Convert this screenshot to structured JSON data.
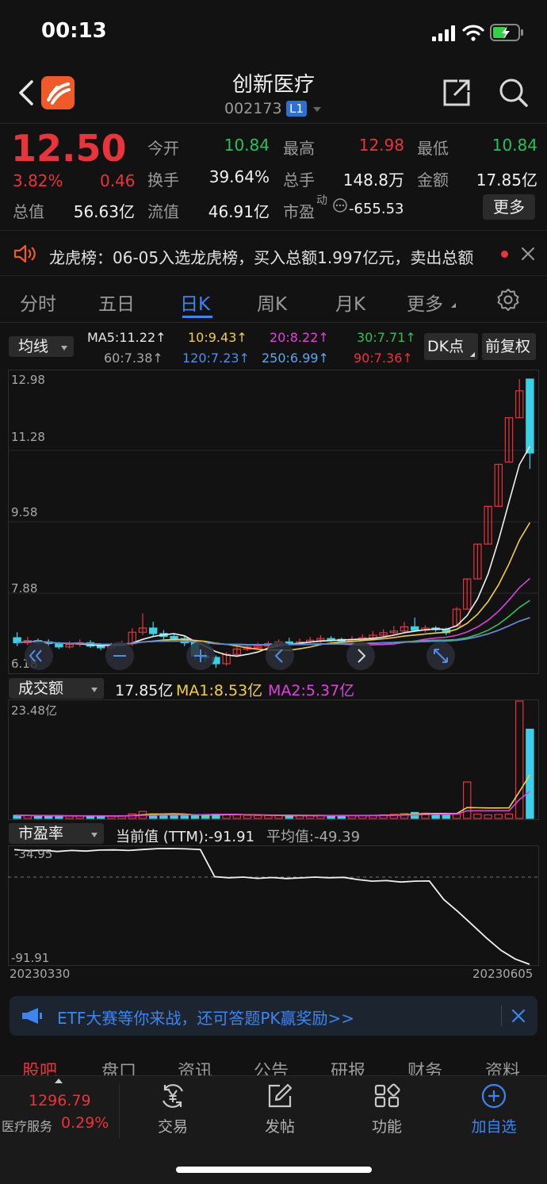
{
  "status": {
    "time": "00:13"
  },
  "header": {
    "title": "创新医疗",
    "code": "002173",
    "level": "L1"
  },
  "quote": {
    "price": "12.50",
    "change_pct": "3.82%",
    "change": "0.46",
    "rows": [
      [
        {
          "label": "今开",
          "value": "10.84",
          "color": "green"
        },
        {
          "label": "最高",
          "value": "12.98",
          "color": "red"
        },
        {
          "label": "最低",
          "value": "10.84",
          "color": "green"
        }
      ],
      [
        {
          "label": "换手",
          "value": "39.64%",
          "color": "white"
        },
        {
          "label": "总手",
          "value": "148.8万",
          "color": "white"
        },
        {
          "label": "金额",
          "value": "17.85亿",
          "color": "white"
        }
      ]
    ],
    "total_value_label": "总值",
    "total_value": "56.63亿",
    "float_value_label": "流值",
    "float_value": "46.91亿",
    "pe_label": "市盈",
    "pe_sup": "动",
    "pe_value": "-655.53",
    "more_label": "更多"
  },
  "notice": {
    "text": "龙虎榜：06-05入选龙虎榜，买入总额1.997亿元，卖出总额"
  },
  "tabs": [
    {
      "label": "分时",
      "active": false
    },
    {
      "label": "五日",
      "active": false
    },
    {
      "label": "日K",
      "active": true
    },
    {
      "label": "周K",
      "active": false
    },
    {
      "label": "月K",
      "active": false
    },
    {
      "label": "更多",
      "active": false
    }
  ],
  "indicator_bar": {
    "select_label": "均线",
    "ma_row1": [
      {
        "text": "MA5:11.22↑",
        "color": "#e8e8e8"
      },
      {
        "text": "10:9.43↑",
        "color": "#f0d040"
      },
      {
        "text": "20:8.22↑",
        "color": "#e040e0"
      },
      {
        "text": "30:7.71↑",
        "color": "#30c050"
      }
    ],
    "ma_row2": [
      {
        "text": "60:7.38↑",
        "color": "#a8a8a8"
      },
      {
        "text": "120:7.23↑",
        "color": "#4f8fe8"
      },
      {
        "text": "250:6.99↑",
        "color": "#5aa8f0"
      },
      {
        "text": "90:7.36↑",
        "color": "#e8343a"
      }
    ],
    "dk_label": "DK点",
    "restore_label": "前复权"
  },
  "chart_data": [
    {
      "type": "candlestick",
      "y_ticks": [
        "12.98",
        "11.28",
        "9.58",
        "7.88",
        "6.18"
      ],
      "ylim": [
        6.18,
        12.98
      ],
      "candles": [
        [
          6.82,
          6.7,
          6.95,
          6.62
        ],
        [
          6.7,
          6.75,
          6.84,
          6.64
        ],
        [
          6.75,
          6.72,
          6.8,
          6.66
        ],
        [
          6.72,
          6.68,
          6.78,
          6.62
        ],
        [
          6.68,
          6.6,
          6.72,
          6.55
        ],
        [
          6.6,
          6.66,
          6.74,
          6.56
        ],
        [
          6.66,
          6.7,
          6.78,
          6.6
        ],
        [
          6.7,
          6.62,
          6.76,
          6.58
        ],
        [
          6.62,
          6.58,
          6.68,
          6.52
        ],
        [
          6.58,
          6.64,
          6.7,
          6.54
        ],
        [
          6.64,
          6.68,
          6.75,
          6.6
        ],
        [
          6.68,
          6.95,
          7.05,
          6.62
        ],
        [
          6.95,
          7.05,
          7.4,
          6.88
        ],
        [
          7.05,
          6.92,
          7.2,
          6.84
        ],
        [
          6.92,
          6.85,
          7.0,
          6.78
        ],
        [
          6.85,
          6.8,
          6.92,
          6.74
        ],
        [
          6.8,
          6.7,
          6.86,
          6.62
        ],
        [
          6.7,
          6.38,
          6.74,
          6.3
        ],
        [
          6.38,
          6.35,
          6.5,
          6.25
        ],
        [
          6.35,
          6.2,
          6.4,
          6.1
        ],
        [
          6.2,
          6.42,
          6.48,
          6.15
        ],
        [
          6.42,
          6.55,
          6.6,
          6.36
        ],
        [
          6.55,
          6.6,
          6.66,
          6.5
        ],
        [
          6.6,
          6.62,
          6.7,
          6.55
        ],
        [
          6.62,
          6.68,
          6.74,
          6.58
        ],
        [
          6.68,
          6.72,
          6.78,
          6.62
        ],
        [
          6.72,
          6.7,
          6.82,
          6.64
        ],
        [
          6.7,
          6.72,
          6.8,
          6.64
        ],
        [
          6.72,
          6.76,
          6.84,
          6.66
        ],
        [
          6.76,
          6.8,
          6.88,
          6.7
        ],
        [
          6.8,
          6.78,
          6.86,
          6.72
        ],
        [
          6.78,
          6.76,
          6.82,
          6.7
        ],
        [
          6.76,
          6.78,
          6.86,
          6.72
        ],
        [
          6.78,
          6.82,
          6.9,
          6.74
        ],
        [
          6.82,
          6.88,
          6.98,
          6.78
        ],
        [
          6.88,
          6.94,
          7.02,
          6.84
        ],
        [
          6.94,
          6.98,
          7.1,
          6.88
        ],
        [
          6.98,
          7.08,
          7.2,
          6.92
        ],
        [
          7.08,
          7.0,
          7.3,
          6.98
        ],
        [
          7.0,
          7.05,
          7.12,
          6.94
        ],
        [
          7.05,
          7.02,
          7.1,
          6.96
        ],
        [
          7.02,
          6.94,
          7.06,
          6.88
        ],
        [
          7.1,
          7.5,
          7.55,
          7.1
        ],
        [
          7.5,
          8.22,
          8.22,
          7.5
        ],
        [
          8.22,
          9.05,
          9.05,
          8.22
        ],
        [
          9.05,
          9.95,
          9.95,
          9.05
        ],
        [
          9.95,
          10.95,
          10.95,
          9.95
        ],
        [
          11.0,
          12.06,
          12.06,
          11.0
        ],
        [
          12.06,
          12.7,
          12.98,
          12.06
        ],
        [
          12.98,
          11.22,
          12.98,
          10.84
        ]
      ]
    },
    {
      "type": "bar",
      "select_label": "成交额",
      "current": "17.85亿",
      "ma1": "MA1:8.53亿",
      "ma2": "MA2:5.37亿",
      "y_max_label": "23.48亿",
      "ylim": [
        0,
        23.48
      ],
      "values": [
        0.62,
        0.58,
        0.55,
        0.5,
        0.45,
        0.48,
        0.52,
        0.5,
        0.46,
        0.48,
        0.52,
        0.9,
        1.4,
        0.9,
        0.75,
        0.62,
        0.58,
        0.72,
        0.78,
        0.85,
        0.8,
        0.7,
        0.62,
        0.58,
        0.55,
        0.55,
        0.52,
        0.58,
        0.6,
        0.62,
        0.58,
        0.55,
        0.56,
        0.6,
        0.65,
        0.72,
        0.82,
        0.95,
        1.2,
        1.05,
        0.9,
        0.8,
        0.85,
        7.3,
        0.85,
        0.7,
        0.78,
        0.9,
        23.48,
        17.85
      ]
    },
    {
      "type": "line",
      "select_label": "市盈率",
      "current": "当前值 (TTM):-91.91",
      "average": "平均值:-49.39",
      "y_top_label": "-34.95",
      "y_bottom_label": "-91.91",
      "x_start": "20230330",
      "x_end": "20230605",
      "ylim": [
        -91.91,
        -34.95
      ],
      "values": [
        -35.5,
        -36.0,
        -35.8,
        -36.4,
        -35.9,
        -36.2,
        -35.7,
        -35.6,
        -35.9,
        -35.4,
        -35.0,
        -34.95,
        -35.1,
        -35.4,
        -48.8,
        -49.3,
        -49.0,
        -49.6,
        -49.2,
        -49.7,
        -49.4,
        -49.0,
        -49.3,
        -49.1,
        -50.2,
        -51.0,
        -50.7,
        -51.4,
        -51.0,
        -50.9,
        -60.0,
        -66.0,
        -72.5,
        -79.0,
        -85.0,
        -89.3,
        -91.91
      ]
    }
  ],
  "banner": {
    "text": "ETF大赛等你来战，还可答题PK赢奖励>>"
  },
  "bottom_tabs": [
    {
      "label": "股吧",
      "active": true
    },
    {
      "label": "盘口",
      "active": false
    },
    {
      "label": "资讯",
      "active": false
    },
    {
      "label": "公告",
      "active": false
    },
    {
      "label": "研报",
      "active": false
    },
    {
      "label": "财务",
      "active": false
    },
    {
      "label": "资料",
      "active": false
    }
  ],
  "bottom_bar": {
    "index_value": "1296.79",
    "index_name": "医疗服务",
    "index_change": "0.29%",
    "items": [
      {
        "label": "交易",
        "icon": "yen-exchange-icon"
      },
      {
        "label": "发帖",
        "icon": "edit-icon"
      },
      {
        "label": "功能",
        "icon": "grid-icon"
      },
      {
        "label": "加自选",
        "icon": "plus-circle-icon"
      }
    ]
  }
}
